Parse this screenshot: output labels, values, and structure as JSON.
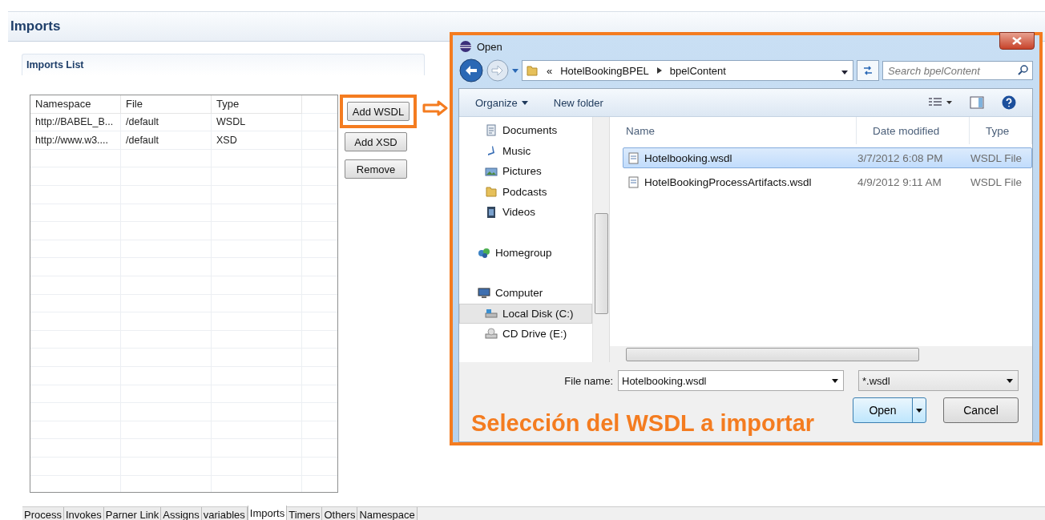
{
  "page": {
    "title": "Imports",
    "section_title": "Imports List"
  },
  "imports_table": {
    "columns": [
      "Namespace",
      "File",
      "Type",
      ""
    ],
    "rows": [
      [
        "http://BABEL_B...",
        "/default",
        "WSDL"
      ],
      [
        "http://www.w3....",
        "/default",
        "XSD"
      ]
    ]
  },
  "buttons": [
    {
      "label": "Add WSDL",
      "highlighted": true
    },
    {
      "label": "Add XSD",
      "highlighted": false
    },
    {
      "label": "Remove",
      "highlighted": false
    }
  ],
  "bottom_tabs": [
    {
      "label": "Process",
      "selected": false
    },
    {
      "label": "Invokes",
      "selected": false
    },
    {
      "label": "Parner Link",
      "selected": false
    },
    {
      "label": "Assigns",
      "selected": false
    },
    {
      "label": "variables",
      "selected": false
    },
    {
      "label": "Imports",
      "selected": true
    },
    {
      "label": "Timers",
      "selected": false
    },
    {
      "label": "Others",
      "selected": false
    },
    {
      "label": "Namespace",
      "selected": false
    }
  ],
  "dialog": {
    "title": "Open",
    "breadcrumb": [
      "«",
      "HotelBookingBPEL",
      "bpelContent"
    ],
    "search": {
      "placeholder": "Search bpelContent"
    },
    "toolbar": [
      "Organize",
      "New folder"
    ],
    "nav_pane": [
      {
        "label": "Documents",
        "kind": "item",
        "selected": false
      },
      {
        "label": "Music",
        "kind": "item",
        "selected": false
      },
      {
        "label": "Pictures",
        "kind": "item",
        "selected": false
      },
      {
        "label": "Podcasts",
        "kind": "item",
        "selected": false
      },
      {
        "label": "Videos",
        "kind": "item",
        "selected": false
      },
      {
        "label": "Homegroup",
        "kind": "group",
        "selected": false
      },
      {
        "label": "Computer",
        "kind": "group",
        "selected": false
      },
      {
        "label": "Local Disk (C:)",
        "kind": "item",
        "selected": true
      },
      {
        "label": "CD Drive (E:)",
        "kind": "item",
        "selected": false
      }
    ],
    "columns": [
      "Name",
      "Date modified",
      "Type"
    ],
    "files": [
      {
        "name": "Hotelbooking.wsdl",
        "date": "3/7/2012 6:08 PM",
        "type": "WSDL File",
        "selected": true
      },
      {
        "name": "HotelBookingProcessArtifacts.wsdl",
        "date": "4/9/2012 9:11 AM",
        "type": "WSDL File",
        "selected": false
      }
    ],
    "file_name_label": "File name:",
    "file_name": "Hotelbooking.wsdl",
    "filter": "*.wsdl",
    "open_button": "Open",
    "cancel_button": "Cancel",
    "caption": "Selección del WSDL a importar"
  }
}
